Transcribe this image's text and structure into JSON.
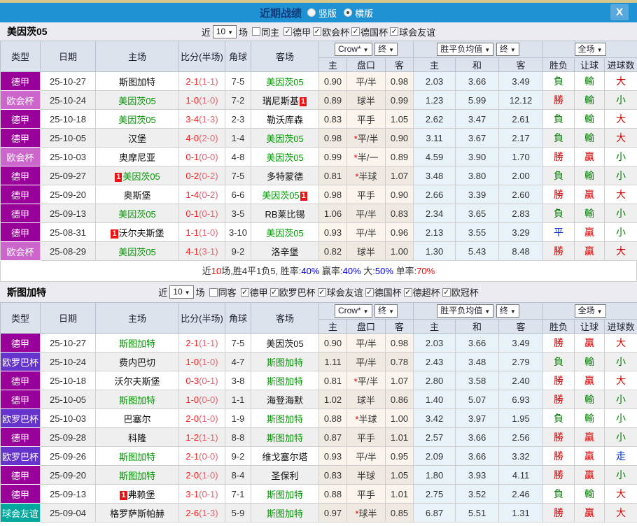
{
  "titlebar": {
    "title": "近期战绩",
    "radios": [
      {
        "label": "竖版",
        "selected": false
      },
      {
        "label": "横版",
        "selected": true
      }
    ],
    "close_label": "X"
  },
  "filters_common": {
    "prefix": "近",
    "rounds": "10",
    "suffix": "场"
  },
  "table_header": {
    "cols": [
      "类型",
      "日期",
      "主场",
      "比分(半场)",
      "角球",
      "客场"
    ],
    "odds_dropdown": "Crow*",
    "odds_final_dropdown": "终",
    "odds_sub": [
      "主",
      "盘口",
      "客"
    ],
    "mean_dropdown": "胜平负均值",
    "mean_final_dropdown": "终",
    "mean_sub": [
      "主",
      "和",
      "客"
    ],
    "scope_dropdown": "全场",
    "result_sub": [
      "胜负",
      "让球",
      "进球数"
    ]
  },
  "type_colors": {
    "德甲": "#990099",
    "欧会杯": "#cc66cc",
    "欧罗巴杯": "#6633cc",
    "球会友谊": "#00a79d"
  },
  "colors": {
    "titlebar": "#1e92d2",
    "close_btn": "#58a8de",
    "top_strip": "#d8c78c",
    "header_bg": "#dce3ec",
    "section_bg": "#ebebf1",
    "row_alt": "#efefef",
    "odds_bg": "#faf4ec",
    "odds_bg_alt": "#efe9e1",
    "mean_bg": "#e8f2f9",
    "win": "#d40000",
    "loss": "#007a00",
    "draw": "#0033cc",
    "score_main": "#ff1a1a",
    "score_half": "#e9606f",
    "team_self": "#009900",
    "badge_bg": "#ee1111"
  },
  "sections": [
    {
      "team": "美因茨05",
      "same_side_label": "同主",
      "same_side_checked": false,
      "leagues": [
        "德甲",
        "欧会杯",
        "德国杯",
        "球会友谊"
      ],
      "rows": [
        {
          "type": "德甲",
          "date": "25-10-27",
          "home": {
            "name": "斯图加特"
          },
          "away": {
            "name": "美因茨05",
            "self": true
          },
          "score": "2-1",
          "half": "(1-1)",
          "corners": "7-5",
          "odds": [
            "0.90",
            "平/半",
            "0.98"
          ],
          "mean": [
            "2.03",
            "3.66",
            "3.49"
          ],
          "res": [
            "負",
            "輸",
            "大"
          ],
          "resc": [
            "g",
            "g",
            "r"
          ]
        },
        {
          "type": "欧会杯",
          "date": "25-10-24",
          "home": {
            "name": "美因茨05",
            "self": true
          },
          "away": {
            "name": "瑞尼斯基",
            "badge": "after"
          },
          "score": "1-0",
          "half": "(1-0)",
          "corners": "7-2",
          "odds": [
            "0.89",
            "球半",
            "0.99"
          ],
          "mean": [
            "1.23",
            "5.99",
            "12.12"
          ],
          "res": [
            "勝",
            "輸",
            "小"
          ],
          "resc": [
            "r",
            "g",
            "g"
          ]
        },
        {
          "type": "德甲",
          "date": "25-10-18",
          "home": {
            "name": "美因茨05",
            "self": true
          },
          "away": {
            "name": "勒沃库森"
          },
          "score": "3-4",
          "half": "(1-3)",
          "corners": "2-3",
          "odds": [
            "0.83",
            "平手",
            "1.05"
          ],
          "mean": [
            "2.62",
            "3.47",
            "2.61"
          ],
          "res": [
            "負",
            "輸",
            "大"
          ],
          "resc": [
            "g",
            "g",
            "r"
          ]
        },
        {
          "type": "德甲",
          "date": "25-10-05",
          "home": {
            "name": "汉堡"
          },
          "away": {
            "name": "美因茨05",
            "self": true
          },
          "score": "4-0",
          "half": "(2-0)",
          "corners": "1-4",
          "odds": [
            "0.98",
            "*平/半",
            "0.90"
          ],
          "mean": [
            "3.11",
            "3.67",
            "2.17"
          ],
          "res": [
            "負",
            "輸",
            "大"
          ],
          "resc": [
            "g",
            "g",
            "r"
          ]
        },
        {
          "type": "欧会杯",
          "date": "25-10-03",
          "home": {
            "name": "奥摩尼亚"
          },
          "away": {
            "name": "美因茨05",
            "self": true
          },
          "score": "0-1",
          "half": "(0-0)",
          "corners": "4-8",
          "odds": [
            "0.99",
            "*半/一",
            "0.89"
          ],
          "mean": [
            "4.59",
            "3.90",
            "1.70"
          ],
          "res": [
            "勝",
            "贏",
            "小"
          ],
          "resc": [
            "r",
            "r",
            "g"
          ]
        },
        {
          "type": "德甲",
          "date": "25-09-27",
          "home": {
            "name": "美因茨05",
            "self": true,
            "badge": "before"
          },
          "away": {
            "name": "多特蒙德"
          },
          "score": "0-2",
          "half": "(0-2)",
          "corners": "7-5",
          "odds": [
            "0.81",
            "*半球",
            "1.07"
          ],
          "mean": [
            "3.48",
            "3.80",
            "2.00"
          ],
          "res": [
            "負",
            "輸",
            "小"
          ],
          "resc": [
            "g",
            "g",
            "g"
          ]
        },
        {
          "type": "德甲",
          "date": "25-09-20",
          "home": {
            "name": "奥斯堡"
          },
          "away": {
            "name": "美因茨05",
            "self": true,
            "badge": "after"
          },
          "score": "1-4",
          "half": "(0-2)",
          "corners": "6-6",
          "odds": [
            "0.98",
            "平手",
            "0.90"
          ],
          "mean": [
            "2.66",
            "3.39",
            "2.60"
          ],
          "res": [
            "勝",
            "贏",
            "大"
          ],
          "resc": [
            "r",
            "r",
            "r"
          ]
        },
        {
          "type": "德甲",
          "date": "25-09-13",
          "home": {
            "name": "美因茨05",
            "self": true
          },
          "away": {
            "name": "RB莱比锡"
          },
          "score": "0-1",
          "half": "(0-1)",
          "corners": "3-5",
          "odds": [
            "1.06",
            "平/半",
            "0.83"
          ],
          "mean": [
            "2.34",
            "3.65",
            "2.83"
          ],
          "res": [
            "負",
            "輸",
            "小"
          ],
          "resc": [
            "g",
            "g",
            "g"
          ]
        },
        {
          "type": "德甲",
          "date": "25-08-31",
          "home": {
            "name": "沃尔夫斯堡",
            "badge": "before"
          },
          "away": {
            "name": "美因茨05",
            "self": true
          },
          "score": "1-1",
          "half": "(1-0)",
          "corners": "3-10",
          "odds": [
            "0.93",
            "平/半",
            "0.96"
          ],
          "mean": [
            "2.13",
            "3.55",
            "3.29"
          ],
          "res": [
            "平",
            "贏",
            "小"
          ],
          "resc": [
            "b",
            "r",
            "g"
          ]
        },
        {
          "type": "欧会杯",
          "date": "25-08-29",
          "home": {
            "name": "美因茨05",
            "self": true
          },
          "away": {
            "name": "洛辛堡"
          },
          "score": "4-1",
          "half": "(3-1)",
          "corners": "9-2",
          "odds": [
            "0.82",
            "球半",
            "1.00"
          ],
          "mean": [
            "1.30",
            "5.43",
            "8.48"
          ],
          "res": [
            "勝",
            "贏",
            "大"
          ],
          "resc": [
            "r",
            "r",
            "r"
          ]
        }
      ],
      "summary": [
        {
          "text": "近",
          "color": "#333333"
        },
        {
          "text": "10",
          "color": "#ff0000"
        },
        {
          "text": "场,胜4平1负5, 胜率:",
          "color": "#333333"
        },
        {
          "text": "40%",
          "color": "#0000ff"
        },
        {
          "text": " 赢率:",
          "color": "#333333"
        },
        {
          "text": "40%",
          "color": "#0000ff"
        },
        {
          "text": " 大:",
          "color": "#333333"
        },
        {
          "text": "50%",
          "color": "#0000ff"
        },
        {
          "text": " 单率:",
          "color": "#333333"
        },
        {
          "text": "70%",
          "color": "#ff0000"
        }
      ]
    },
    {
      "team": "斯图加特",
      "same_side_label": "同客",
      "same_side_checked": false,
      "leagues": [
        "德甲",
        "欧罗巴杯",
        "球会友谊",
        "德国杯",
        "德超杯",
        "欧冠杯"
      ],
      "rows": [
        {
          "type": "德甲",
          "date": "25-10-27",
          "home": {
            "name": "斯图加特",
            "self": true
          },
          "away": {
            "name": "美因茨05"
          },
          "score": "2-1",
          "half": "(1-1)",
          "corners": "7-5",
          "odds": [
            "0.90",
            "平/半",
            "0.98"
          ],
          "mean": [
            "2.03",
            "3.66",
            "3.49"
          ],
          "res": [
            "勝",
            "贏",
            "大"
          ],
          "resc": [
            "r",
            "r",
            "r"
          ]
        },
        {
          "type": "欧罗巴杯",
          "date": "25-10-24",
          "home": {
            "name": "费内巴切"
          },
          "away": {
            "name": "斯图加特",
            "self": true
          },
          "score": "1-0",
          "half": "(1-0)",
          "corners": "4-7",
          "odds": [
            "1.11",
            "平/半",
            "0.78"
          ],
          "mean": [
            "2.43",
            "3.48",
            "2.79"
          ],
          "res": [
            "負",
            "輸",
            "小"
          ],
          "resc": [
            "g",
            "g",
            "g"
          ]
        },
        {
          "type": "德甲",
          "date": "25-10-18",
          "home": {
            "name": "沃尔夫斯堡"
          },
          "away": {
            "name": "斯图加特",
            "self": true
          },
          "score": "0-3",
          "half": "(0-1)",
          "corners": "3-8",
          "odds": [
            "0.81",
            "*平/半",
            "1.07"
          ],
          "mean": [
            "2.80",
            "3.58",
            "2.40"
          ],
          "res": [
            "勝",
            "贏",
            "大"
          ],
          "resc": [
            "r",
            "r",
            "r"
          ]
        },
        {
          "type": "德甲",
          "date": "25-10-05",
          "home": {
            "name": "斯图加特",
            "self": true
          },
          "away": {
            "name": "海登海默"
          },
          "score": "1-0",
          "half": "(0-0)",
          "corners": "1-1",
          "odds": [
            "1.02",
            "球半",
            "0.86"
          ],
          "mean": [
            "1.40",
            "5.07",
            "6.93"
          ],
          "res": [
            "勝",
            "輸",
            "小"
          ],
          "resc": [
            "r",
            "g",
            "g"
          ]
        },
        {
          "type": "欧罗巴杯",
          "date": "25-10-03",
          "home": {
            "name": "巴塞尔"
          },
          "away": {
            "name": "斯图加特",
            "self": true
          },
          "score": "2-0",
          "half": "(1-0)",
          "corners": "1-9",
          "odds": [
            "0.88",
            "*半球",
            "1.00"
          ],
          "mean": [
            "3.42",
            "3.97",
            "1.95"
          ],
          "res": [
            "負",
            "輸",
            "小"
          ],
          "resc": [
            "g",
            "g",
            "g"
          ]
        },
        {
          "type": "德甲",
          "date": "25-09-28",
          "home": {
            "name": "科隆"
          },
          "away": {
            "name": "斯图加特",
            "self": true
          },
          "score": "1-2",
          "half": "(1-1)",
          "corners": "8-8",
          "odds": [
            "0.87",
            "平手",
            "1.01"
          ],
          "mean": [
            "2.57",
            "3.66",
            "2.56"
          ],
          "res": [
            "勝",
            "贏",
            "小"
          ],
          "resc": [
            "r",
            "r",
            "g"
          ]
        },
        {
          "type": "欧罗巴杯",
          "date": "25-09-26",
          "home": {
            "name": "斯图加特",
            "self": true
          },
          "away": {
            "name": "维戈塞尔塔"
          },
          "score": "2-1",
          "half": "(0-0)",
          "corners": "9-2",
          "odds": [
            "0.93",
            "平/半",
            "0.95"
          ],
          "mean": [
            "2.09",
            "3.66",
            "3.32"
          ],
          "res": [
            "勝",
            "贏",
            "走"
          ],
          "resc": [
            "r",
            "r",
            "b"
          ]
        },
        {
          "type": "德甲",
          "date": "25-09-20",
          "home": {
            "name": "斯图加特",
            "self": true
          },
          "away": {
            "name": "圣保利"
          },
          "score": "2-0",
          "half": "(1-0)",
          "corners": "8-4",
          "odds": [
            "0.83",
            "半球",
            "1.05"
          ],
          "mean": [
            "1.80",
            "3.93",
            "4.11"
          ],
          "res": [
            "勝",
            "贏",
            "小"
          ],
          "resc": [
            "r",
            "r",
            "g"
          ]
        },
        {
          "type": "德甲",
          "date": "25-09-13",
          "home": {
            "name": "弗赖堡",
            "badge": "before"
          },
          "away": {
            "name": "斯图加特",
            "self": true
          },
          "score": "3-1",
          "half": "(0-1)",
          "corners": "7-1",
          "odds": [
            "0.88",
            "平手",
            "1.01"
          ],
          "mean": [
            "2.75",
            "3.52",
            "2.46"
          ],
          "res": [
            "負",
            "輸",
            "大"
          ],
          "resc": [
            "g",
            "g",
            "r"
          ]
        },
        {
          "type": "球会友谊",
          "date": "25-09-04",
          "home": {
            "name": "格罗萨斯帕赫"
          },
          "away": {
            "name": "斯图加特",
            "self": true
          },
          "score": "2-6",
          "half": "(1-3)",
          "corners": "5-9",
          "odds": [
            "0.97",
            "*球半",
            "0.85"
          ],
          "mean": [
            "6.87",
            "5.51",
            "1.31"
          ],
          "res": [
            "勝",
            "贏",
            "大"
          ],
          "resc": [
            "r",
            "r",
            "r"
          ]
        }
      ],
      "summary": []
    }
  ]
}
